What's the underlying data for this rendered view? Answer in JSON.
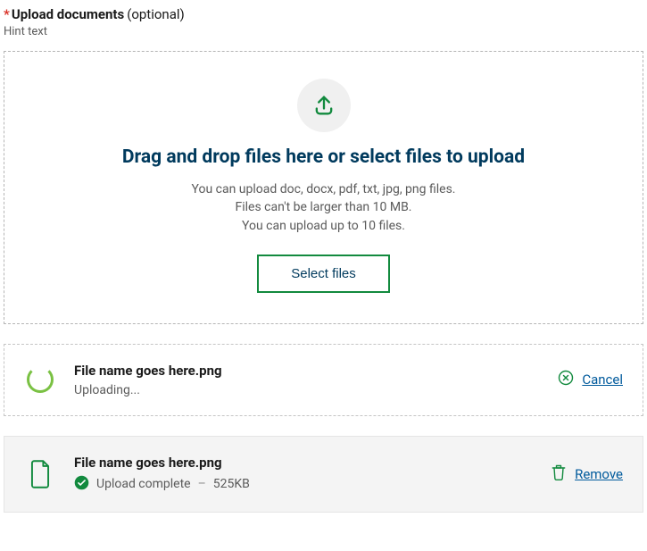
{
  "field": {
    "required_marker": "*",
    "label": "Upload documents",
    "optional": "(optional)",
    "hint": "Hint text"
  },
  "dropzone": {
    "heading": "Drag and drop files here or select files to upload",
    "line1": "You can upload doc, docx, pdf, txt, jpg, png files.",
    "line2": "Files can't be larger than 10 MB.",
    "line3": "You can upload up to 10 files.",
    "select_button": "Select files"
  },
  "files": {
    "uploading": {
      "name": "File name goes here.png",
      "status": "Uploading...",
      "action": "Cancel"
    },
    "complete": {
      "name": "File name goes here.png",
      "status": "Upload complete",
      "separator": "–",
      "size": "525KB",
      "action": "Remove"
    }
  },
  "colors": {
    "green": "#128a3e",
    "lime": "#7ac143",
    "blue": "#005a9c",
    "heading_blue": "#003a5d"
  }
}
